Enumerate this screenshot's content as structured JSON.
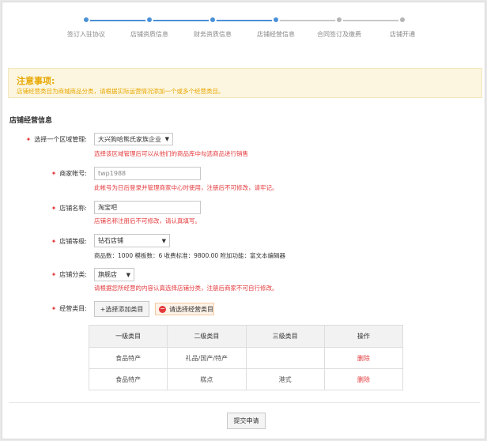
{
  "steps": [
    {
      "label": "签订入驻协议",
      "state": "done"
    },
    {
      "label": "店铺资质信息",
      "state": "done"
    },
    {
      "label": "财务资质信息",
      "state": "done"
    },
    {
      "label": "店铺经营信息",
      "state": "current"
    },
    {
      "label": "合同签订及缴费",
      "state": "todo"
    },
    {
      "label": "店铺开通",
      "state": "todo"
    }
  ],
  "colors": {
    "accent": "#4a90d9",
    "inactive": "#c0c0c0",
    "error": "#e4393c",
    "warning": "#e7a700"
  },
  "notice": {
    "title": "注意事项:",
    "text": "店铺经营类目为商城商品分类，请根据实际运营情况添加一个或多个经营类目。"
  },
  "section_title": "店铺经营信息",
  "form": {
    "region": {
      "label": "选择一个区域管理:",
      "value": "大兴狗哈熊氏家族企业",
      "hint": "选择该区域管理后可以从他们的商品库中勾选商品进行销售"
    },
    "merchant_account": {
      "label": "商家帐号:",
      "value": "twp1988",
      "hint": "此帐号为日后登录并管理商家中心时使用，注册后不可修改，请牢记。"
    },
    "store_name": {
      "label": "店铺名称:",
      "value": "淘宝吧",
      "hint": "店铺名称注册后不可修改，请认真填写。"
    },
    "store_level": {
      "label": "店铺等级:",
      "value": "钻石店铺",
      "info": "商品数：1000 模板数：6 收费标准：9800.00 附加功能：富文本编辑器"
    },
    "store_category": {
      "label": "店铺分类:",
      "value": "旗舰店",
      "hint": "请根据您所经营的内容认真选择店铺分类，注册后商家不可自行修改。"
    },
    "business_category": {
      "label": "经营类目:",
      "add_button": "+选择添加类目",
      "warning": "请选择经营类目",
      "warning_icon": "minus-circle-icon"
    }
  },
  "category_table": {
    "headers": [
      "一级类目",
      "二级类目",
      "三级类目",
      "操作"
    ],
    "rows": [
      {
        "level1": "食品特产",
        "level2": "礼品/国产/特产",
        "level3": "",
        "action": "删除"
      },
      {
        "level1": "食品特产",
        "level2": "糕点",
        "level3": "港式",
        "action": "删除"
      }
    ]
  },
  "submit_label": "提交申请"
}
